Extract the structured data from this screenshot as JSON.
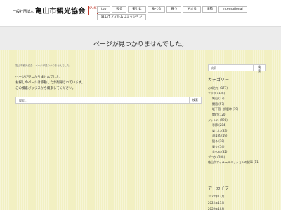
{
  "header": {
    "org_small": "一般社団法人",
    "org_name": "亀山市観光協会",
    "seal_text": "KAMEYAMA"
  },
  "nav": {
    "row1": [
      "top",
      "観る",
      "楽しむ",
      "食べる",
      "買う",
      "泊まる",
      "季節",
      "International"
    ],
    "row2": [
      "亀山市フィルムコミッション"
    ]
  },
  "page": {
    "title": "ページが見つかりませんでした。",
    "breadcrumb": "亀山市観光協会 › ページが見つかりませんでした",
    "message_lines": [
      "ページが見つかりませんでした。",
      "お探しのページは移動したか削除されています。",
      "この検索ボックスから検索してください。"
    ],
    "search_placeholder": "検索...",
    "search_button": "検索"
  },
  "sidebar": {
    "search_placeholder": "検索...",
    "search_button": "検索",
    "category_heading": "カテゴリー",
    "categories": [
      {
        "label": "お知らせ (177)",
        "level": 0
      },
      {
        "label": "エリア (340)",
        "level": 0
      },
      {
        "label": "亀山 (27)",
        "level": 1
      },
      {
        "label": "関宿 (57)",
        "level": 1
      },
      {
        "label": "坂下宿・鈴鹿峠 (19)",
        "level": 1
      },
      {
        "label": "関町 (120)",
        "level": 1
      },
      {
        "label": "ジャンル (998)",
        "level": 0
      },
      {
        "label": "季節 (284)",
        "level": 1
      },
      {
        "label": "楽しむ (83)",
        "level": 1
      },
      {
        "label": "泊まる (19)",
        "level": 1
      },
      {
        "label": "観る (18)",
        "level": 1
      },
      {
        "label": "買う (54)",
        "level": 1
      },
      {
        "label": "食べる (32)",
        "level": 1
      },
      {
        "label": "ブログ (280)",
        "level": 0
      },
      {
        "label": "亀山市フィルムコミッションの記事 (11)",
        "level": 0
      }
    ],
    "archive_heading": "アーカイブ",
    "archives": [
      "2022年12月",
      "2022年11月",
      "2022年10月"
    ]
  },
  "colors": {
    "content_bg": "#f2f0c2",
    "title_band": "#ececec",
    "seal_red": "#c0392b"
  }
}
